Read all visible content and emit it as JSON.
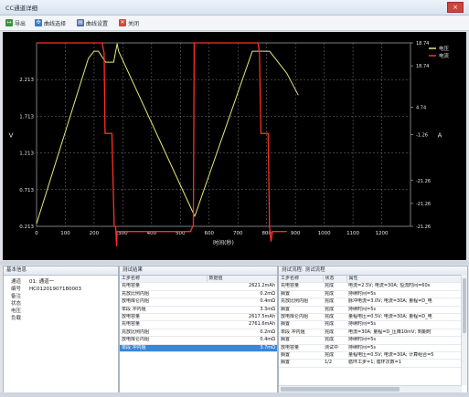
{
  "window": {
    "title": "CC通道详细",
    "close_label": "×"
  },
  "toolbar": {
    "export_label": "导出",
    "curve_select_label": "曲线选择",
    "curve_settings_label": "曲线设置",
    "close_label": "关闭"
  },
  "chart_data": {
    "type": "line",
    "xlabel": "时间(秒)",
    "ylabel_left": "V",
    "ylabel_right": "A",
    "x_ticks": [
      0,
      100,
      200,
      300,
      400,
      500,
      600,
      700,
      800,
      900,
      1000,
      1100,
      1200
    ],
    "y_left_ticks": [
      "0.213",
      "0.713",
      "1.213",
      "1.713",
      "2.213"
    ],
    "y_right_ticks": [
      "-21.26",
      "-21.26",
      "-21.26",
      "-1.26",
      "4.74",
      "18.74",
      "18.74"
    ],
    "xlim": [
      0,
      1300
    ],
    "ylim_left": [
      0.213,
      2.713
    ],
    "ylim_right": [
      -21.26,
      18.74
    ],
    "legend": [
      "电压",
      "电流"
    ],
    "legend_position": "top-right",
    "grid": true,
    "series": [
      {
        "name": "电压",
        "color": "#e8e87a",
        "axis": "left",
        "points": [
          [
            0,
            0.25
          ],
          [
            180,
            2.5
          ],
          [
            200,
            2.6
          ],
          [
            215,
            2.6
          ],
          [
            240,
            2.45
          ],
          [
            268,
            2.45
          ],
          [
            280,
            2.7
          ],
          [
            285,
            2.6
          ],
          [
            550,
            0.35
          ],
          [
            750,
            2.6
          ],
          [
            810,
            2.6
          ],
          [
            870,
            2.3
          ],
          [
            910,
            2.0
          ]
        ]
      },
      {
        "name": "电流",
        "color": "#ff2e24",
        "axis": "right",
        "points": [
          [
            0,
            18.74
          ],
          [
            200,
            18.74
          ],
          [
            215,
            18.74
          ],
          [
            228,
            18.74
          ],
          [
            235,
            16.5
          ],
          [
            238,
            -1.0
          ],
          [
            262,
            -1.0
          ],
          [
            270,
            -21.26
          ],
          [
            275,
            -21.26
          ],
          [
            278,
            -25.5
          ],
          [
            280,
            -22.4
          ],
          [
            535,
            -22.4
          ],
          [
            545,
            -21.0
          ],
          [
            548,
            18.74
          ],
          [
            740,
            18.74
          ],
          [
            770,
            18.74
          ],
          [
            775,
            16.5
          ],
          [
            780,
            -1.0
          ],
          [
            805,
            -1.0
          ],
          [
            810,
            -21.26
          ],
          [
            815,
            -24.5
          ],
          [
            820,
            -22.4
          ],
          [
            870,
            -22.4
          ]
        ]
      }
    ]
  },
  "basic_info": {
    "header": "基本信息",
    "rows": [
      {
        "key": "通道",
        "value": "01: 通道一"
      },
      {
        "key": "编号",
        "value": "HC01201907180003"
      },
      {
        "key": "备注",
        "value": ""
      },
      {
        "key": "状态",
        "value": ""
      },
      {
        "key": "电压",
        "value": ""
      },
      {
        "key": "负载",
        "value": ""
      }
    ]
  },
  "results": {
    "header": "测试结果",
    "columns": [
      "工步名称",
      "数据值"
    ],
    "rows": [
      [
        "充电容量",
        "2621.2mAh"
      ],
      [
        "充放比例内阻",
        "0.2mΩ"
      ],
      [
        "放电库仑内阻",
        "0.4mΩ"
      ],
      [
        "单段 冲内阻",
        "3.3mΩ"
      ],
      [
        "放电容量",
        "2617.5mAh"
      ],
      [
        "充电容量",
        "2761.6mAh"
      ],
      [
        "充放比例内阻",
        "0.2mΩ"
      ],
      [
        "放电库仑内阻",
        "0.4mΩ"
      ],
      [
        "单段 冲内阻",
        "3.7mΩ"
      ]
    ],
    "selected_index": 8
  },
  "process": {
    "header": "测试流程: 测试流程",
    "columns": [
      "工步名称",
      "状态",
      "属性"
    ],
    "rows": [
      [
        "充电容量",
        "完成",
        "电流=2.5V; 电流=30A; 恒流时间=60s"
      ],
      [
        "搁置",
        "完成",
        "持续时间=5s"
      ],
      [
        "充放比例内阻",
        "完成",
        "脉冲电流=3.0V; 电流=30A; 量程=D_电"
      ],
      [
        "搁置",
        "完成",
        "持续时间=5s"
      ],
      [
        "放电库仑内阻",
        "完成",
        "量程电压=0.5V; 电流=30A; 量程=D_电"
      ],
      [
        "搁置",
        "完成",
        "持续时间=5s"
      ],
      [
        "单段 冲内阻",
        "完成",
        "电流=30A; 量程=D_压降10mV; 到期时"
      ],
      [
        "搁置",
        "完成",
        "持续时间=5s"
      ],
      [
        "放电容量",
        "测试中",
        "持续时间=5s"
      ],
      [
        "搁置",
        "完成",
        "量程电压=0.5V; 电流=30A; 计算组合=5"
      ],
      [
        "搁置",
        "1/2",
        "循环工步=1; 循环次数=1"
      ]
    ]
  },
  "colors": {
    "voltage": "#e8e87a",
    "current": "#ff2e24",
    "grid": "#7a7a7a",
    "axis_text": "#e6e6e6",
    "selection": "#3a86d8"
  }
}
